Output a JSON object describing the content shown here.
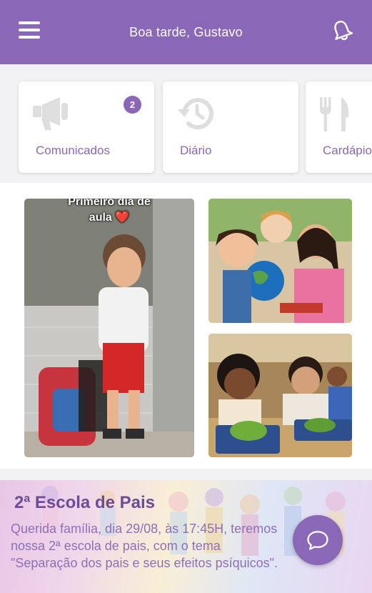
{
  "header": {
    "greeting": "Boa tarde, Gustavo",
    "menu_icon": "hamburger-menu-icon",
    "bell_icon": "bell-icon"
  },
  "cards": [
    {
      "label": "Comunicados",
      "icon": "megaphone-icon",
      "badge": "2"
    },
    {
      "label": "Diário",
      "icon": "history-clock-icon"
    },
    {
      "label": "Cardápio",
      "icon": "fork-knife-icon"
    }
  ],
  "gallery": {
    "photos": [
      {
        "caption": "Primeiro dia de\naula ❤️"
      },
      {
        "caption": ""
      },
      {
        "caption": ""
      }
    ]
  },
  "news": {
    "title": "2ª Escola de Pais",
    "body": "Querida família, dia 29/08, às 17:45H, teremos nossa 2ª escola de pais, com o tema \"Separação dos pais e seus efeitos psíquicos\"."
  },
  "chat_icon": "chat-bubble-icon",
  "colors": {
    "primary": "#8b67b8",
    "icon_gray": "#dedede",
    "background": "#f2f2f4"
  }
}
